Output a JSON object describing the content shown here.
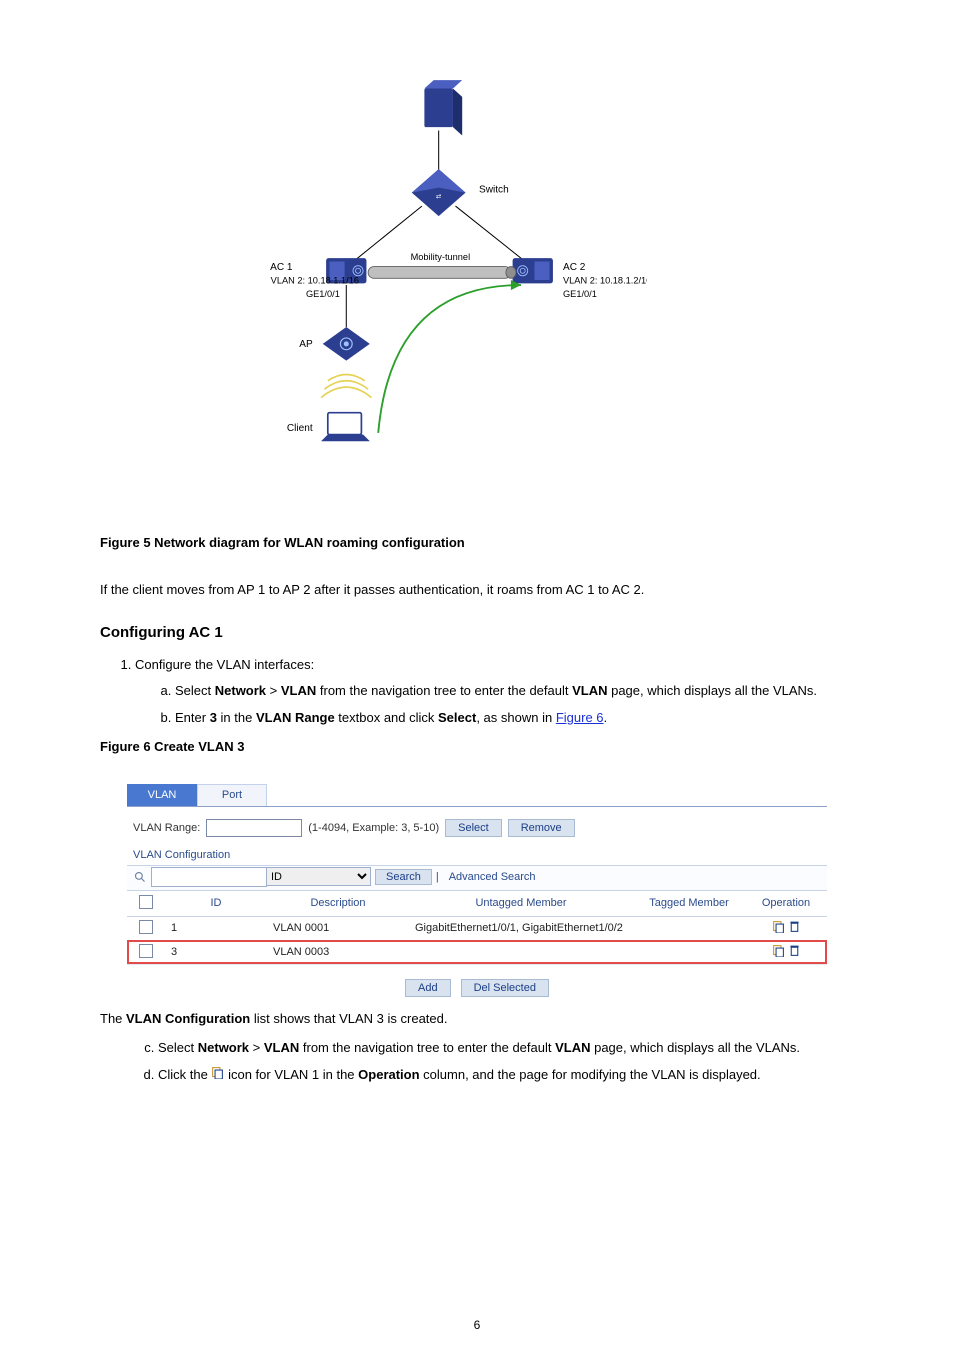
{
  "figure5": {
    "caption": "Figure 5 Network diagram for WLAN roaming configuration",
    "nodes": {
      "server": "server-node",
      "switch": "Switch",
      "ac1": "wireless-controller-1",
      "ac2": "wireless-controller-2",
      "ap": "access-point",
      "client": "Client"
    },
    "labels": {
      "switch_ip": "Switch",
      "ac1_name": "AC 1",
      "ac2_name": "AC 2",
      "vlan_line": "VLAN 2: 10.18.1.1/16",
      "ge_line": "GE1/0/1",
      "mt_line": "Mobility-tunnel",
      "ap_name": "AP",
      "client_name": "Client"
    }
  },
  "paragraph_under_fig": "If the client moves from AP 1 to AP 2 after it passes authentication, it roams from AC 1 to AC 2.",
  "heading": "Configuring AC 1",
  "steps": [
    "Configure the VLAN interfaces:",
    "Select Network > VLAN from the navigation tree to enter the default VLAN page, which displays all the VLANs.",
    "Enter 3 in the VLAN Range textbox and click Select, as shown in Figure 6."
  ],
  "nav_link": "Figure 6",
  "figure6_caption": "Figure 6 Create VLAN 3",
  "panel": {
    "tabs": {
      "vlan": "VLAN",
      "port": "Port"
    },
    "vlan_range_label": "VLAN Range:",
    "vlan_range_value": "",
    "vlan_range_hint": "(1-4094, Example: 3, 5-10)",
    "select_btn": "Select",
    "remove_btn": "Remove",
    "subheading": "VLAN Configuration",
    "search_select": "ID",
    "search_btn": "Search",
    "advanced": "Advanced Search",
    "columns": {
      "chk": "",
      "id": "ID",
      "desc": "Description",
      "untagged": "Untagged Member",
      "tagged": "Tagged Member",
      "op": "Operation"
    },
    "rows": [
      {
        "id": "1",
        "desc": "VLAN 0001",
        "untagged": "GigabitEthernet1/0/1, GigabitEthernet1/0/2",
        "tagged": ""
      },
      {
        "id": "3",
        "desc": "VLAN 0003",
        "untagged": "",
        "tagged": ""
      }
    ],
    "add_btn": "Add",
    "del_btn": "Del Selected"
  },
  "after_panel_paragraph": "The VLAN Configuration list shows that VLAN 3 is created.",
  "step4a": "Select Network > VLAN from the navigation tree to enter the default VLAN page, which displays all the VLANs.",
  "step4b": "Click the  icon for VLAN 1 in the Operation column, and the page for modifying the VLAN is displayed.",
  "page_number": "6"
}
